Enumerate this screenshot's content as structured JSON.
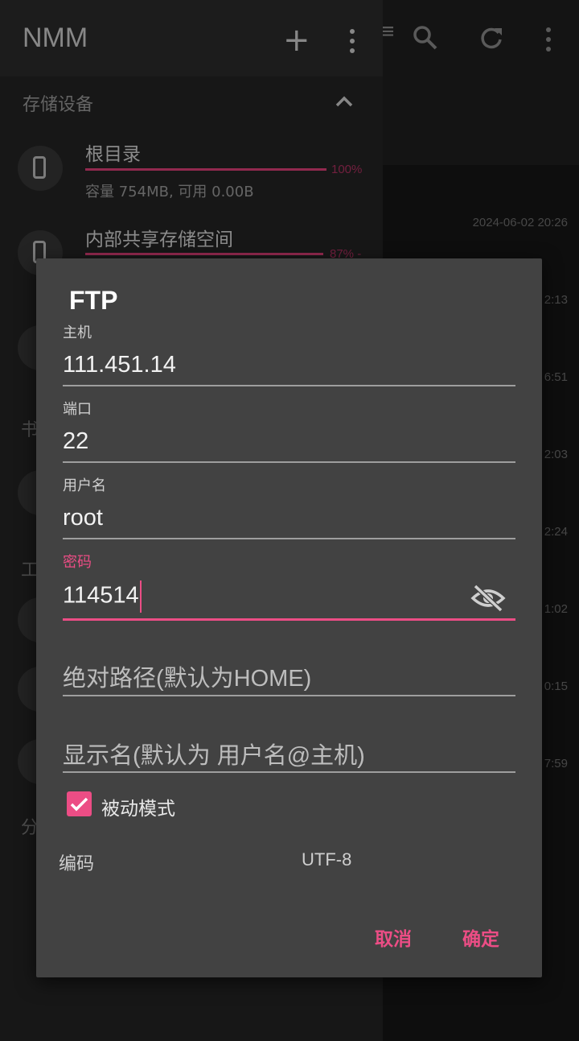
{
  "app": {
    "title": "NMM"
  },
  "drawer": {
    "section_storage": "存储设备",
    "storages": [
      {
        "name": "根目录",
        "percent": 100,
        "percent_label": "100%",
        "capacity": "容量 754MB, 可用 0.00B"
      },
      {
        "name": "内部共享存储空间",
        "percent": 87,
        "percent_label": "87% -"
      }
    ],
    "partial_labels": [
      "书",
      "工",
      "分"
    ]
  },
  "background": {
    "timestamps": [
      "2024-06-02 20:26",
      "2:13",
      "6:51",
      "2:03",
      "2:24",
      "1:02",
      "0:15",
      "7:59"
    ]
  },
  "dialog": {
    "title": "FTP",
    "host": {
      "label": "主机",
      "value": "111.451.14"
    },
    "port": {
      "label": "端口",
      "value": "22"
    },
    "username": {
      "label": "用户名",
      "value": "root"
    },
    "password": {
      "label": "密码",
      "value": "114514"
    },
    "path": {
      "placeholder": "绝对路径(默认为HOME)"
    },
    "display_name": {
      "placeholder": "显示名(默认为 用户名@主机)"
    },
    "passive_mode": {
      "label": "被动模式",
      "checked": true
    },
    "encoding": {
      "label": "编码",
      "value": "UTF-8"
    },
    "cancel_label": "取消",
    "ok_label": "确定"
  },
  "colors": {
    "accent": "#ec4d85",
    "dialog_bg": "#424242",
    "drawer_bg": "#242424"
  }
}
